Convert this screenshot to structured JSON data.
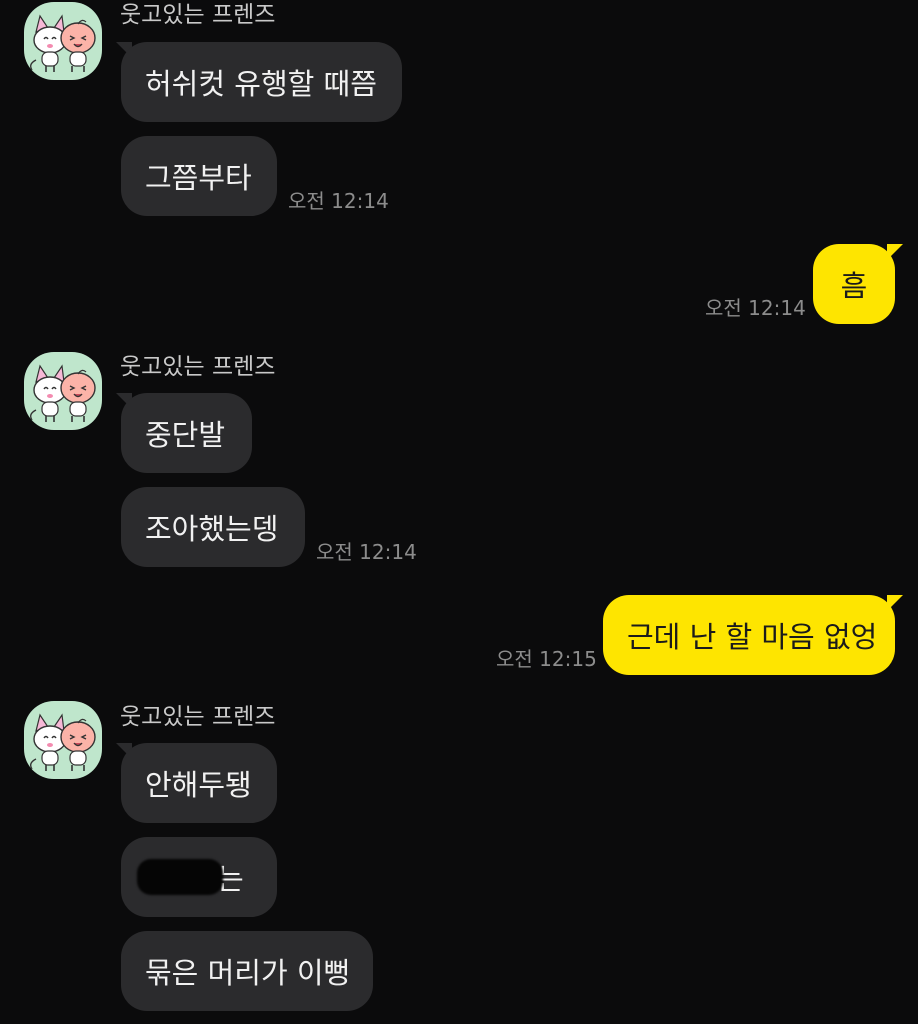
{
  "chat": {
    "groups": [
      {
        "sender": "웃고있는 프렌즈",
        "messages": [
          "허쉬컷 유행할 때쯤",
          "그쯤부타"
        ],
        "time": "오전 12:14"
      },
      {
        "sender": "웃고있는 프렌즈",
        "messages": [
          "중단발",
          "조아했는뎅"
        ],
        "time": "오전 12:14"
      },
      {
        "sender": "웃고있는 프렌즈",
        "messages": [
          "안해두됑",
          "는",
          "묶은 머리가 이뻥"
        ]
      }
    ],
    "outgoing": [
      {
        "text": "흠",
        "time": "오전 12:14"
      },
      {
        "text": "근데 난 할 마음 없엉",
        "time": "오전 12:15"
      }
    ]
  },
  "colors": {
    "background": "#0b0b0c",
    "incoming_bubble": "#2b2b2d",
    "outgoing_bubble": "#fee500",
    "avatar_bg": "#bfe6cc"
  },
  "icons": {
    "avatar": "friends-character-avatar-icon"
  }
}
